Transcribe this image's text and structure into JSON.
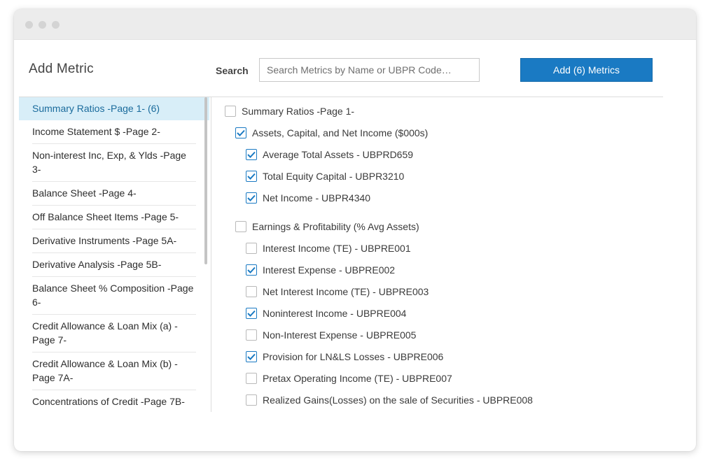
{
  "header": {
    "title": "Add Metric",
    "search_label": "Search",
    "search_placeholder": "Search Metrics by Name or UBPR Code…",
    "add_button_label": "Add (6) Metrics"
  },
  "categories": [
    {
      "label": "Summary Ratios -Page 1- (6)",
      "active": true
    },
    {
      "label": "Income Statement $ -Page 2-"
    },
    {
      "label": "Non-interest Inc, Exp, & Ylds -Page 3-"
    },
    {
      "label": "Balance Sheet -Page 4-"
    },
    {
      "label": "Off Balance Sheet Items -Page 5-"
    },
    {
      "label": "Derivative Instruments -Page 5A-"
    },
    {
      "label": "Derivative Analysis -Page 5B-"
    },
    {
      "label": "Balance Sheet % Composition -Page 6-"
    },
    {
      "label": "Credit Allowance & Loan Mix (a) -Page 7-"
    },
    {
      "label": "Credit Allowance & Loan Mix (b) -Page 7A-"
    },
    {
      "label": "Concentrations of Credit -Page 7B-"
    }
  ],
  "tree": [
    {
      "label": "Summary Ratios -Page 1-",
      "level": 0,
      "checked": false
    },
    {
      "label": "Assets, Capital, and Net Income ($000s)",
      "level": 1,
      "checked": true
    },
    {
      "label": "Average Total Assets - UBPRD659",
      "level": 2,
      "checked": true
    },
    {
      "label": "Total Equity Capital - UBPR3210",
      "level": 2,
      "checked": true
    },
    {
      "label": "Net Income - UBPR4340",
      "level": 2,
      "checked": true
    },
    {
      "label": "Earnings & Profitability (% Avg Assets)",
      "level": 1,
      "checked": false,
      "gap": true
    },
    {
      "label": "Interest Income (TE) - UBPRE001",
      "level": 2,
      "checked": false
    },
    {
      "label": "Interest Expense - UBPRE002",
      "level": 2,
      "checked": true
    },
    {
      "label": "Net Interest Income (TE) - UBPRE003",
      "level": 2,
      "checked": false
    },
    {
      "label": "Noninterest Income - UBPRE004",
      "level": 2,
      "checked": true
    },
    {
      "label": "Non-Interest Expense - UBPRE005",
      "level": 2,
      "checked": false
    },
    {
      "label": "Provision for LN&LS Losses - UBPRE006",
      "level": 2,
      "checked": true
    },
    {
      "label": "Pretax Operating Income (TE) - UBPRE007",
      "level": 2,
      "checked": false
    },
    {
      "label": "Realized Gains(Losses) on the sale of Securities - UBPRE008",
      "level": 2,
      "checked": false
    }
  ],
  "colors": {
    "accent": "#1a7ac3",
    "active_bg": "#d8eef8",
    "active_text": "#1a6b9c"
  }
}
